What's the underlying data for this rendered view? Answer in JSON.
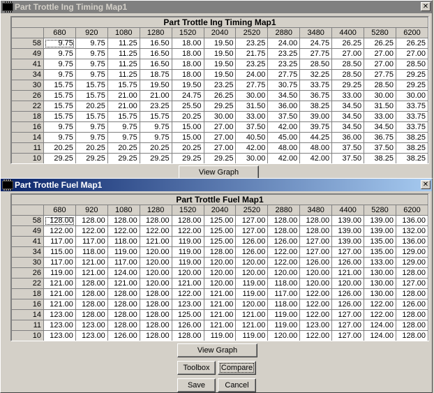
{
  "timing": {
    "window_title": "Part Trottle Ing Timing Map1",
    "grid_title": "Part Trottle Ing Timing Map1",
    "columns": [
      "680",
      "920",
      "1080",
      "1280",
      "1520",
      "2040",
      "2520",
      "2880",
      "3480",
      "4400",
      "5280",
      "6200"
    ],
    "rows": [
      {
        "label": "58",
        "cells": [
          "9.75",
          "9.75",
          "11.25",
          "16.50",
          "18.00",
          "19.50",
          "23.25",
          "24.00",
          "24.75",
          "26.25",
          "26.25",
          "26.25"
        ]
      },
      {
        "label": "49",
        "cells": [
          "9.75",
          "9.75",
          "11.25",
          "16.50",
          "18.00",
          "19.50",
          "21.75",
          "23.25",
          "27.75",
          "27.00",
          "27.00",
          "27.00"
        ]
      },
      {
        "label": "41",
        "cells": [
          "9.75",
          "9.75",
          "11.25",
          "16.50",
          "18.00",
          "19.50",
          "23.25",
          "23.25",
          "28.50",
          "28.50",
          "27.00",
          "28.50"
        ]
      },
      {
        "label": "34",
        "cells": [
          "9.75",
          "9.75",
          "11.25",
          "18.75",
          "18.00",
          "19.50",
          "24.00",
          "27.75",
          "32.25",
          "28.50",
          "27.75",
          "29.25"
        ]
      },
      {
        "label": "30",
        "cells": [
          "15.75",
          "15.75",
          "15.75",
          "19.50",
          "19.50",
          "23.25",
          "27.75",
          "30.75",
          "33.75",
          "29.25",
          "28.50",
          "29.25"
        ]
      },
      {
        "label": "26",
        "cells": [
          "15.75",
          "15.75",
          "21.00",
          "21.00",
          "24.75",
          "26.25",
          "30.00",
          "34.50",
          "36.75",
          "33.00",
          "30.00",
          "30.00"
        ]
      },
      {
        "label": "22",
        "cells": [
          "15.75",
          "20.25",
          "21.00",
          "23.25",
          "25.50",
          "29.25",
          "31.50",
          "36.00",
          "38.25",
          "34.50",
          "31.50",
          "33.75"
        ]
      },
      {
        "label": "18",
        "cells": [
          "15.75",
          "15.75",
          "15.75",
          "15.75",
          "20.25",
          "30.00",
          "33.00",
          "37.50",
          "39.00",
          "34.50",
          "33.00",
          "33.75"
        ]
      },
      {
        "label": "16",
        "cells": [
          "9.75",
          "9.75",
          "9.75",
          "9.75",
          "15.00",
          "27.00",
          "37.50",
          "42.00",
          "39.75",
          "34.50",
          "34.50",
          "33.75"
        ]
      },
      {
        "label": "14",
        "cells": [
          "9.75",
          "9.75",
          "9.75",
          "9.75",
          "15.00",
          "27.00",
          "40.50",
          "45.00",
          "44.25",
          "36.00",
          "36.75",
          "38.25"
        ]
      },
      {
        "label": "11",
        "cells": [
          "20.25",
          "20.25",
          "20.25",
          "20.25",
          "20.25",
          "27.00",
          "42.00",
          "48.00",
          "48.00",
          "37.50",
          "37.50",
          "38.25"
        ]
      },
      {
        "label": "10",
        "cells": [
          "29.25",
          "29.25",
          "29.25",
          "29.25",
          "29.25",
          "29.25",
          "30.00",
          "42.00",
          "42.00",
          "37.50",
          "38.25",
          "38.25"
        ]
      }
    ],
    "view_graph_label": "View Graph"
  },
  "fuel": {
    "window_title": "Part Trottle Fuel Map1",
    "grid_title": "Part Trottle Fuel Map1",
    "columns": [
      "680",
      "920",
      "1080",
      "1280",
      "1520",
      "2040",
      "2520",
      "2880",
      "3480",
      "4400",
      "5280",
      "6200"
    ],
    "rows": [
      {
        "label": "58",
        "cells": [
          "128.00",
          "128.00",
          "128.00",
          "128.00",
          "128.00",
          "125.00",
          "127.00",
          "128.00",
          "128.00",
          "139.00",
          "139.00",
          "136.00"
        ]
      },
      {
        "label": "49",
        "cells": [
          "122.00",
          "122.00",
          "122.00",
          "122.00",
          "122.00",
          "125.00",
          "127.00",
          "128.00",
          "128.00",
          "139.00",
          "139.00",
          "132.00"
        ]
      },
      {
        "label": "41",
        "cells": [
          "117.00",
          "117.00",
          "118.00",
          "121.00",
          "119.00",
          "125.00",
          "126.00",
          "126.00",
          "127.00",
          "139.00",
          "135.00",
          "136.00"
        ]
      },
      {
        "label": "34",
        "cells": [
          "115.00",
          "118.00",
          "119.00",
          "120.00",
          "119.00",
          "128.00",
          "126.00",
          "122.00",
          "127.00",
          "127.00",
          "135.00",
          "129.00"
        ]
      },
      {
        "label": "30",
        "cells": [
          "117.00",
          "121.00",
          "117.00",
          "120.00",
          "119.00",
          "120.00",
          "120.00",
          "122.00",
          "126.00",
          "126.00",
          "133.00",
          "129.00"
        ]
      },
      {
        "label": "26",
        "cells": [
          "119.00",
          "121.00",
          "124.00",
          "120.00",
          "120.00",
          "120.00",
          "120.00",
          "120.00",
          "120.00",
          "121.00",
          "130.00",
          "128.00"
        ]
      },
      {
        "label": "22",
        "cells": [
          "121.00",
          "128.00",
          "121.00",
          "120.00",
          "121.00",
          "120.00",
          "119.00",
          "118.00",
          "120.00",
          "120.00",
          "130.00",
          "127.00"
        ]
      },
      {
        "label": "18",
        "cells": [
          "121.00",
          "128.00",
          "128.00",
          "128.00",
          "122.00",
          "121.00",
          "119.00",
          "117.00",
          "122.00",
          "126.00",
          "130.00",
          "128.00"
        ]
      },
      {
        "label": "16",
        "cells": [
          "121.00",
          "128.00",
          "128.00",
          "128.00",
          "123.00",
          "121.00",
          "120.00",
          "118.00",
          "122.00",
          "126.00",
          "122.00",
          "126.00"
        ]
      },
      {
        "label": "14",
        "cells": [
          "123.00",
          "128.00",
          "128.00",
          "128.00",
          "125.00",
          "121.00",
          "121.00",
          "119.00",
          "122.00",
          "127.00",
          "122.00",
          "128.00"
        ]
      },
      {
        "label": "11",
        "cells": [
          "123.00",
          "123.00",
          "128.00",
          "128.00",
          "126.00",
          "121.00",
          "121.00",
          "119.00",
          "123.00",
          "127.00",
          "124.00",
          "128.00"
        ]
      },
      {
        "label": "10",
        "cells": [
          "123.00",
          "123.00",
          "126.00",
          "128.00",
          "128.00",
          "119.00",
          "119.00",
          "120.00",
          "122.00",
          "127.00",
          "124.00",
          "128.00"
        ]
      }
    ],
    "view_graph_label": "View Graph"
  },
  "buttons": {
    "toolbox": "Toolbox",
    "compare": "Compare",
    "save": "Save",
    "cancel": "Cancel"
  },
  "icons": {
    "app": "chip-icon",
    "close": "close-icon",
    "close_glyph": "✕"
  }
}
